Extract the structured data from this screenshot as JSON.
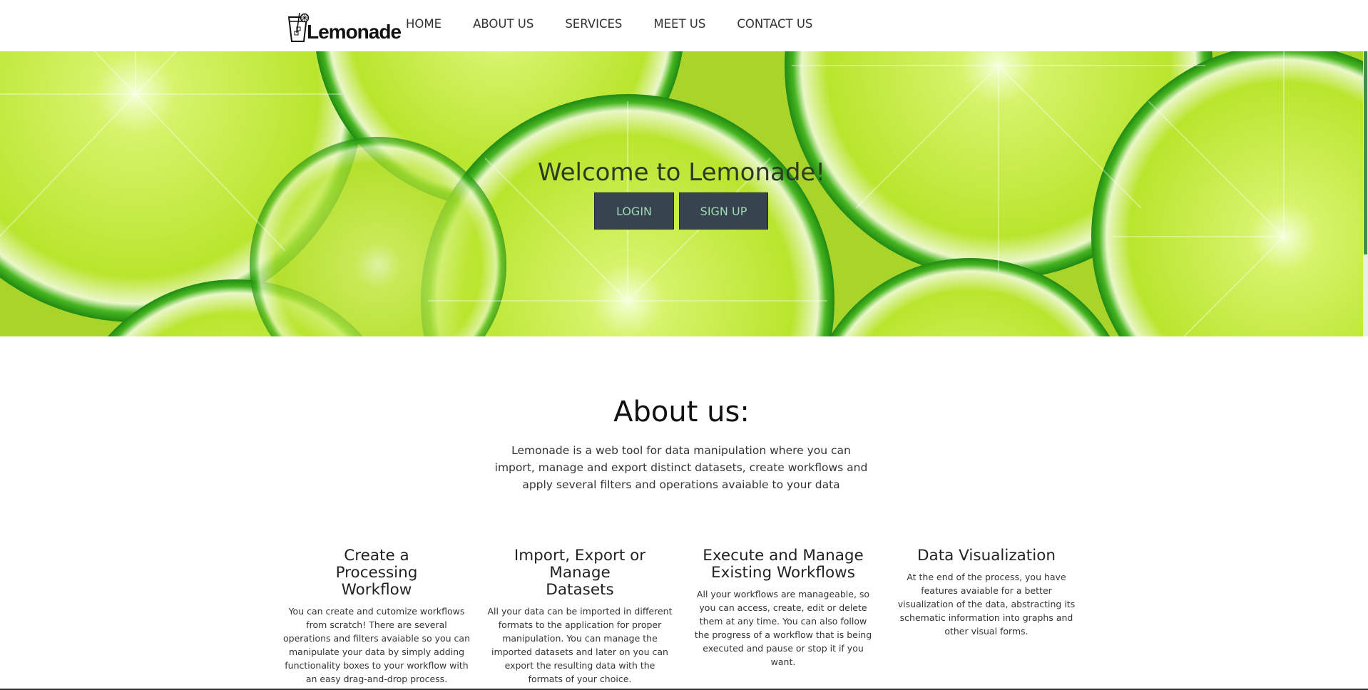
{
  "brand": {
    "name": "Lemonade"
  },
  "nav": {
    "items": [
      {
        "label": "HOME"
      },
      {
        "label": "ABOUT US"
      },
      {
        "label": "SERVICES"
      },
      {
        "label": "MEET US"
      },
      {
        "label": "CONTACT US"
      }
    ]
  },
  "hero": {
    "title": "Welcome to Lemonade!",
    "login_label": "LOGIN",
    "signup_label": "SIGN UP"
  },
  "about": {
    "title": "About us:",
    "text": "Lemonade is a web tool for data manipulation where you can import, manage and export distinct datasets, create workflows and apply several filters and operations avaiable to your data"
  },
  "features": [
    {
      "title": "Create a Processing Workflow",
      "text": "You can create and cutomize workflows from scratch! There are several operations and filters avaiable so you can manipulate your data by simply adding functionality boxes to your workflow with an easy drag-and-drop process."
    },
    {
      "title": "Import, Export or Manage Datasets",
      "text": "All your data can be imported in different formats to the application for proper manipulation. You can manage the imported datasets and later on you can export the resulting data with the formats of your choice."
    },
    {
      "title": "Execute and Manage Existing Workflows",
      "text": "All your workflows are manageable, so you can access, create, edit or delete them at any time. You can also follow the progress of a workflow that is being executed and pause or stop it if you want."
    },
    {
      "title": "Data Visualization",
      "text": "At the end of the process, you have features avaiable for a better visualization of the data, abstracting its schematic information into graphs and other visual forms."
    }
  ],
  "colors": {
    "button_bg": "#374450",
    "button_text": "#9fd9b4",
    "lime": "#b8e02a"
  }
}
